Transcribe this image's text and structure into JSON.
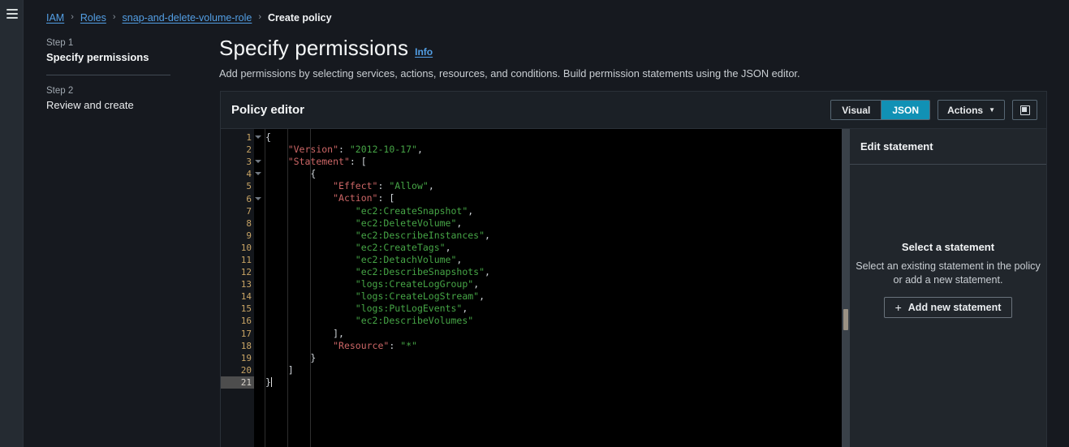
{
  "nav": {
    "menu_icon": "hamburger-icon"
  },
  "breadcrumb": {
    "items": [
      {
        "label": "IAM",
        "current": false
      },
      {
        "label": "Roles",
        "current": false
      },
      {
        "label": "snap-and-delete-volume-role",
        "current": false
      },
      {
        "label": "Create policy",
        "current": true
      }
    ],
    "separator": "›"
  },
  "steps": [
    {
      "eyebrow": "Step 1",
      "title": "Specify permissions",
      "active": true
    },
    {
      "eyebrow": "Step 2",
      "title": "Review and create",
      "active": false
    }
  ],
  "header": {
    "title": "Specify permissions",
    "info_label": "Info",
    "description": "Add permissions by selecting services, actions, resources, and conditions. Build permission statements using the JSON editor."
  },
  "editor": {
    "heading": "Policy editor",
    "mode_visual": "Visual",
    "mode_json": "JSON",
    "selected_mode": "JSON",
    "actions_label": "Actions",
    "actions_caret": "▼",
    "panel_toggle_icon": "side-panel-icon",
    "active_line": 21,
    "fold_lines": [
      1,
      3,
      4,
      6
    ],
    "lines": [
      {
        "n": 1,
        "indent": 0,
        "tokens": [
          {
            "t": "brace",
            "v": "{"
          }
        ]
      },
      {
        "n": 2,
        "indent": 1,
        "tokens": [
          {
            "t": "key",
            "v": "\"Version\""
          },
          {
            "t": "punct",
            "v": ": "
          },
          {
            "t": "str",
            "v": "\"2012-10-17\""
          },
          {
            "t": "punct",
            "v": ","
          }
        ]
      },
      {
        "n": 3,
        "indent": 1,
        "tokens": [
          {
            "t": "key",
            "v": "\"Statement\""
          },
          {
            "t": "punct",
            "v": ": "
          },
          {
            "t": "brace",
            "v": "["
          }
        ]
      },
      {
        "n": 4,
        "indent": 2,
        "tokens": [
          {
            "t": "brace",
            "v": "{"
          }
        ]
      },
      {
        "n": 5,
        "indent": 3,
        "tokens": [
          {
            "t": "key",
            "v": "\"Effect\""
          },
          {
            "t": "punct",
            "v": ": "
          },
          {
            "t": "str",
            "v": "\"Allow\""
          },
          {
            "t": "punct",
            "v": ","
          }
        ]
      },
      {
        "n": 6,
        "indent": 3,
        "tokens": [
          {
            "t": "key",
            "v": "\"Action\""
          },
          {
            "t": "punct",
            "v": ": "
          },
          {
            "t": "brace",
            "v": "["
          }
        ]
      },
      {
        "n": 7,
        "indent": 4,
        "tokens": [
          {
            "t": "str",
            "v": "\"ec2:CreateSnapshot\""
          },
          {
            "t": "punct",
            "v": ","
          }
        ]
      },
      {
        "n": 8,
        "indent": 4,
        "tokens": [
          {
            "t": "str",
            "v": "\"ec2:DeleteVolume\""
          },
          {
            "t": "punct",
            "v": ","
          }
        ]
      },
      {
        "n": 9,
        "indent": 4,
        "tokens": [
          {
            "t": "str",
            "v": "\"ec2:DescribeInstances\""
          },
          {
            "t": "punct",
            "v": ","
          }
        ]
      },
      {
        "n": 10,
        "indent": 4,
        "tokens": [
          {
            "t": "str",
            "v": "\"ec2:CreateTags\""
          },
          {
            "t": "punct",
            "v": ","
          }
        ]
      },
      {
        "n": 11,
        "indent": 4,
        "tokens": [
          {
            "t": "str",
            "v": "\"ec2:DetachVolume\""
          },
          {
            "t": "punct",
            "v": ","
          }
        ]
      },
      {
        "n": 12,
        "indent": 4,
        "tokens": [
          {
            "t": "str",
            "v": "\"ec2:DescribeSnapshots\""
          },
          {
            "t": "punct",
            "v": ","
          }
        ]
      },
      {
        "n": 13,
        "indent": 4,
        "tokens": [
          {
            "t": "str",
            "v": "\"logs:CreateLogGroup\""
          },
          {
            "t": "punct",
            "v": ","
          }
        ]
      },
      {
        "n": 14,
        "indent": 4,
        "tokens": [
          {
            "t": "str",
            "v": "\"logs:CreateLogStream\""
          },
          {
            "t": "punct",
            "v": ","
          }
        ]
      },
      {
        "n": 15,
        "indent": 4,
        "tokens": [
          {
            "t": "str",
            "v": "\"logs:PutLogEvents\""
          },
          {
            "t": "punct",
            "v": ","
          }
        ]
      },
      {
        "n": 16,
        "indent": 4,
        "tokens": [
          {
            "t": "str",
            "v": "\"ec2:DescribeVolumes\""
          }
        ]
      },
      {
        "n": 17,
        "indent": 3,
        "tokens": [
          {
            "t": "brace",
            "v": "]"
          },
          {
            "t": "punct",
            "v": ","
          }
        ]
      },
      {
        "n": 18,
        "indent": 3,
        "tokens": [
          {
            "t": "key",
            "v": "\"Resource\""
          },
          {
            "t": "punct",
            "v": ": "
          },
          {
            "t": "str",
            "v": "\"*\""
          }
        ]
      },
      {
        "n": 19,
        "indent": 2,
        "tokens": [
          {
            "t": "brace",
            "v": "}"
          }
        ]
      },
      {
        "n": 20,
        "indent": 1,
        "tokens": [
          {
            "t": "brace",
            "v": "]"
          }
        ]
      },
      {
        "n": 21,
        "indent": 0,
        "tokens": [
          {
            "t": "brace",
            "v": "}"
          }
        ]
      }
    ]
  },
  "statement_panel": {
    "header": "Edit statement",
    "empty_title": "Select a statement",
    "empty_description": "Select an existing statement in the policy or add a new statement.",
    "add_button": "Add new statement",
    "add_button_icon": "plus-icon"
  },
  "colors": {
    "accent_selected": "#1191b5",
    "link": "#539fe5",
    "page_bg": "#16191f",
    "panel_bg": "#1b2026",
    "code_bg": "#000000",
    "statement_panel_bg": "#21262c",
    "gutter_number": "#c8a465",
    "json_key": "#cc6666",
    "json_string": "#46a546"
  }
}
